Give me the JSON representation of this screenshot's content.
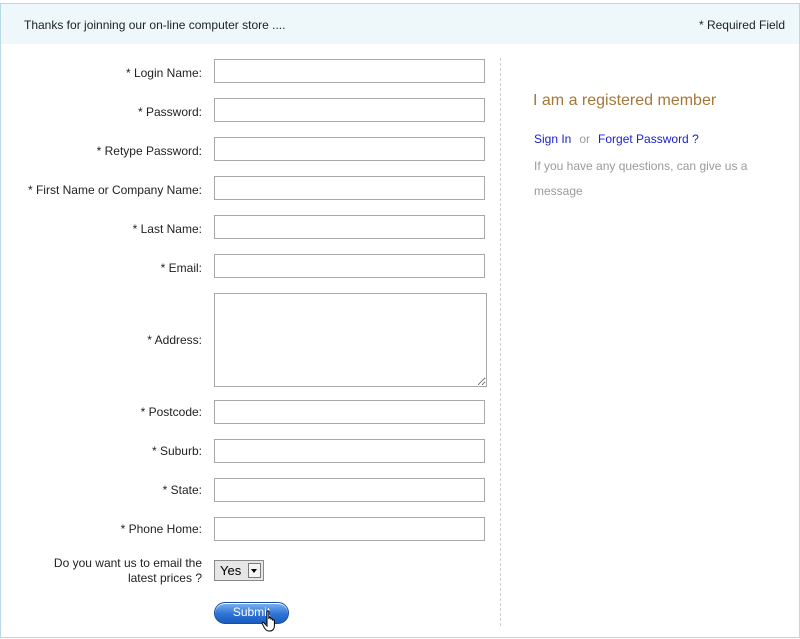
{
  "header": {
    "welcome_text": "Thanks for joinning our on-line computer store ....",
    "required_note": "* Required Field"
  },
  "form": {
    "fields": [
      {
        "label": "* Login Name:",
        "value": ""
      },
      {
        "label": "* Password:",
        "value": ""
      },
      {
        "label": "* Retype Password:",
        "value": ""
      },
      {
        "label": "* First Name or Company Name:",
        "value": ""
      },
      {
        "label": "* Last Name:",
        "value": ""
      },
      {
        "label": "* Email:",
        "value": ""
      },
      {
        "label": "* Address:",
        "value": ""
      },
      {
        "label": "* Postcode:",
        "value": ""
      },
      {
        "label": "* Suburb:",
        "value": ""
      },
      {
        "label": "* State:",
        "value": ""
      },
      {
        "label": "* Phone Home:",
        "value": ""
      }
    ],
    "prices_question_line1": "Do you want us to email the",
    "prices_question_line2": "latest prices ?",
    "prices_selected": "Yes",
    "submit_label": "Submit"
  },
  "member": {
    "title": "I am a registered member",
    "sign_in": "Sign In",
    "or": "or",
    "forget_password": "Forget Password ?",
    "message": "If you have any questions, can give us a message"
  },
  "colors": {
    "accent_title": "#a7773a",
    "link": "#1a22cc",
    "header_bg": "#eef7fa",
    "button": "#2e74d6"
  }
}
